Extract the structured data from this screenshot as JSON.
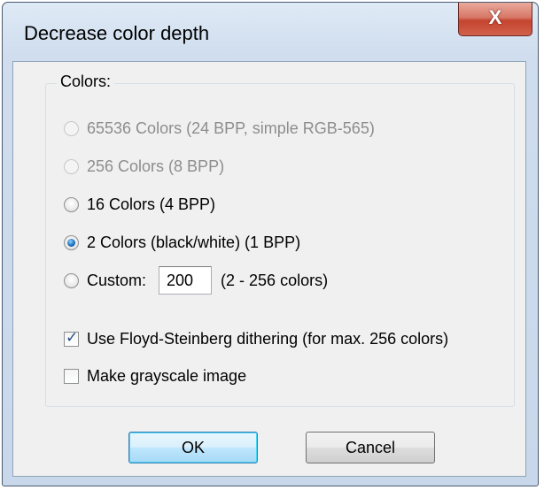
{
  "dialog": {
    "title": "Decrease color depth",
    "close_label": "X",
    "colors_group": {
      "label": "Colors:",
      "options": [
        {
          "label": "65536 Colors (24 BPP, simple RGB-565)",
          "enabled": false,
          "selected": false
        },
        {
          "label": "256 Colors (8 BPP)",
          "enabled": false,
          "selected": false
        },
        {
          "label": "16 Colors (4 BPP)",
          "enabled": true,
          "selected": false
        },
        {
          "label": "2 Colors (black/white) (1 BPP)",
          "enabled": true,
          "selected": true
        }
      ],
      "custom": {
        "label": "Custom:",
        "value": "200",
        "range_hint": "(2 - 256 colors)",
        "selected": false
      },
      "dithering": {
        "label": "Use Floyd-Steinberg dithering (for max. 256 colors)",
        "checked": true
      },
      "grayscale": {
        "label": "Make grayscale image",
        "checked": false
      }
    },
    "buttons": {
      "ok": "OK",
      "cancel": "Cancel"
    }
  }
}
